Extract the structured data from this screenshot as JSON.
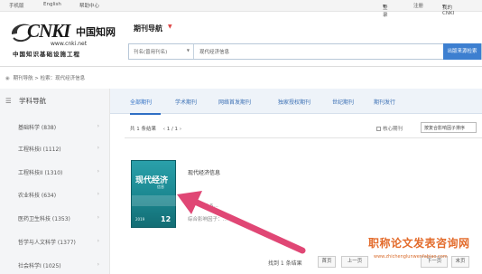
{
  "topbar": {
    "mobile": "手机版",
    "english": "English",
    "help": "帮助中心",
    "login": "登录",
    "register": "注册",
    "my_cnki": "我的CNKI"
  },
  "logo": {
    "brand": "CNKI",
    "url": "www.cnki.net",
    "slogan": "中国知识基础设施工程",
    "brand_cn": "中国知网"
  },
  "header": {
    "nav_title": "期刊导航"
  },
  "search": {
    "field": "刊名(曾用刊名)",
    "value": "现代经济信息",
    "button": "出版来源检索"
  },
  "breadcrumb": {
    "text": "期刊导航 > 检索：现代经济信息"
  },
  "sidebar": {
    "title": "学科导航",
    "items": [
      {
        "label": "基础科学 (838)"
      },
      {
        "label": "工程科技I (1112)"
      },
      {
        "label": "工程科技II (1310)"
      },
      {
        "label": "农业科技 (634)"
      },
      {
        "label": "医药卫生科技 (1353)"
      },
      {
        "label": "哲学与人文科学 (1377)"
      },
      {
        "label": "社会科学I (1025)"
      }
    ]
  },
  "tabs": [
    {
      "label": "全部期刊",
      "active": true
    },
    {
      "label": "学术期刊",
      "active": false
    },
    {
      "label": "网络首发期刊",
      "active": false
    },
    {
      "label": "独家授权期刊",
      "active": false
    },
    {
      "label": "世纪期刊",
      "active": false
    },
    {
      "label": "期刊发行",
      "active": false
    }
  ],
  "results": {
    "summary": "共 1 条结果",
    "page": "1 / 1",
    "core_only": "核心期刊",
    "sort": "按复合影响因子排序"
  },
  "journal": {
    "title": "现代经济信息",
    "cover_title": "现代经济",
    "cover_sub": "信息",
    "cover_year": "2019",
    "cover_issue": "12",
    "line1": "…1:5…",
    "line2": "综合影响因子：…"
  },
  "pager": {
    "found": "找到 1 条结果",
    "first": "首页",
    "prev": "上一页",
    "next": "下一页",
    "last": "末页"
  },
  "watermark": {
    "title": "职称论文发表咨询网",
    "url": "www.zhichenglunwenfabiao.com"
  },
  "colors": {
    "accent": "#2f6fc4",
    "search_button": "#3d7fd0",
    "cover": "#1b8790",
    "arrow": "#e04775",
    "watermark": "#e36b2b"
  }
}
